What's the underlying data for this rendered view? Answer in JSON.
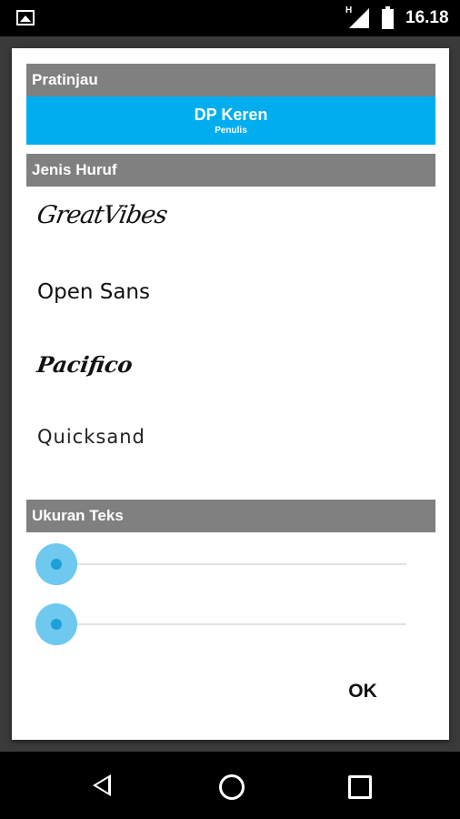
{
  "status_bar": {
    "network_type": "H",
    "time": "16.18",
    "icons": [
      "image-icon",
      "signal-icon",
      "battery-icon"
    ]
  },
  "dialog": {
    "preview_header": "Pratinjau",
    "preview": {
      "title": "DP Keren",
      "subtitle": "Penulis",
      "background_color": "#00aeef"
    },
    "font_header": "Jenis Huruf",
    "fonts": [
      "GreatVibes",
      "Open Sans",
      "Pacifico",
      "Quicksand"
    ],
    "size_header": "Ukuran Teks",
    "sliders": [
      {
        "name": "text-size-slider-1",
        "value": 0
      },
      {
        "name": "text-size-slider-2",
        "value": 0
      }
    ],
    "ok_label": "OK"
  },
  "nav_bar": {
    "icons": [
      "back-icon",
      "home-icon",
      "recents-icon"
    ]
  },
  "colors": {
    "accent": "#00aeef",
    "section_header": "#808080",
    "slider_thumb": "#1d9fd9"
  }
}
